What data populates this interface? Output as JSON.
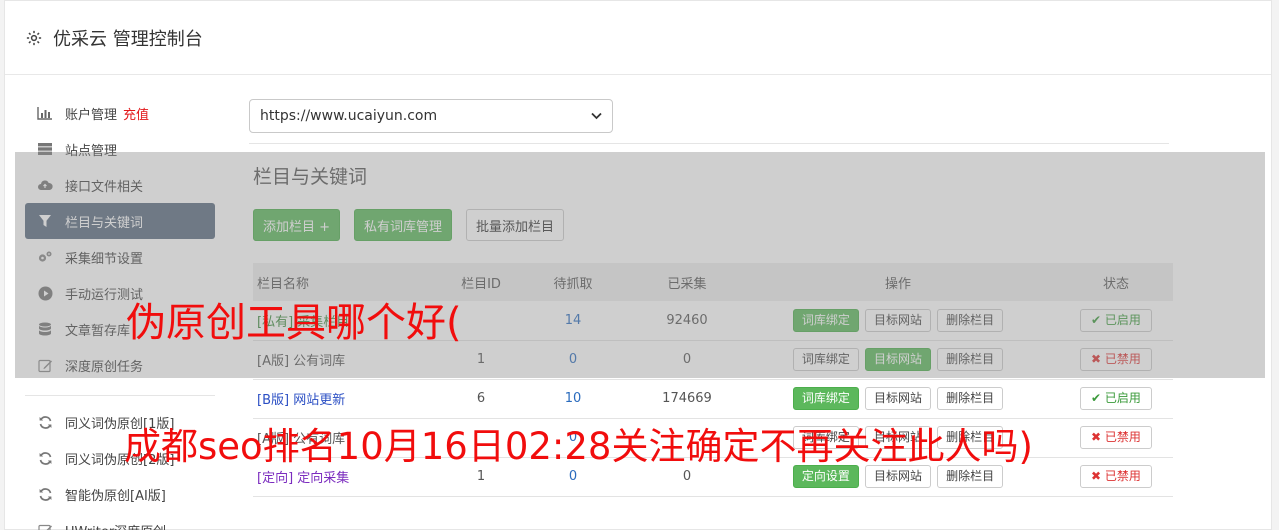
{
  "header": {
    "title": "优采云 管理控制台"
  },
  "sidebar": {
    "items": [
      {
        "label": "账户管理",
        "extra": "充值",
        "icon": "bar-chart-icon"
      },
      {
        "label": "站点管理",
        "icon": "server-icon"
      },
      {
        "label": "接口文件相关",
        "icon": "cloud-upload-icon"
      },
      {
        "label": "栏目与关键词",
        "icon": "filter-icon",
        "active": true
      },
      {
        "label": "采集细节设置",
        "icon": "cogs-icon"
      },
      {
        "label": "手动运行测试",
        "icon": "play-circle-icon"
      },
      {
        "label": "文章暂存库",
        "icon": "database-icon"
      },
      {
        "label": "深度原创任务",
        "icon": "edit-icon"
      }
    ],
    "items2": [
      {
        "label": "同义词伪原创[1版]",
        "icon": "refresh-icon"
      },
      {
        "label": "同义词伪原创[2版]",
        "icon": "refresh-icon"
      },
      {
        "label": "智能伪原创[AI版]",
        "icon": "refresh-icon"
      },
      {
        "label": "UWriter深度原创",
        "icon": "edit-icon"
      }
    ]
  },
  "main": {
    "site_select": "https://www.ucaiyun.com",
    "section_title": "栏目与关键词",
    "buttons": {
      "add": "添加栏目 +",
      "private_lib": "私有词库管理",
      "batch_add": "批量添加栏目"
    },
    "table": {
      "headers": [
        "栏目名称",
        "栏目ID",
        "待抓取",
        "已采集",
        "操作",
        "状态"
      ],
      "actions": {
        "bind": "词库绑定",
        "target": "目标网站",
        "delete": "删除栏目",
        "directed": "定向设置"
      },
      "rows": [
        {
          "name": "[私有] 采集栏目",
          "id": "",
          "pending": "14",
          "collected": "92460",
          "status": "已启用",
          "kind": "private"
        },
        {
          "name": "[A版] 公有词库",
          "id": "1",
          "pending": "0",
          "collected": "0",
          "status": "已禁用",
          "kind": "a"
        },
        {
          "name": "[B版] 网站更新",
          "id": "6",
          "pending": "10",
          "collected": "174669",
          "status": "已启用",
          "kind": "b"
        },
        {
          "name": "[A版] 公有词库",
          "id": "",
          "pending": "0",
          "collected": "",
          "status": "已禁用",
          "kind": "a"
        },
        {
          "name": "[定向] 定向采集",
          "id": "1",
          "pending": "0",
          "collected": "0",
          "status": "已禁用",
          "kind": "dir"
        }
      ]
    }
  },
  "watermark": {
    "line1": "伪原创工具哪个好(",
    "line2": "成都seo排名10月16日02:28关注确定不再关注此人吗)"
  },
  "colors": {
    "accent_green": "#5cb85c",
    "active_nav": "#5b6c80",
    "watermark_red": "#f10d0d",
    "charge_red": "#e3171a"
  }
}
